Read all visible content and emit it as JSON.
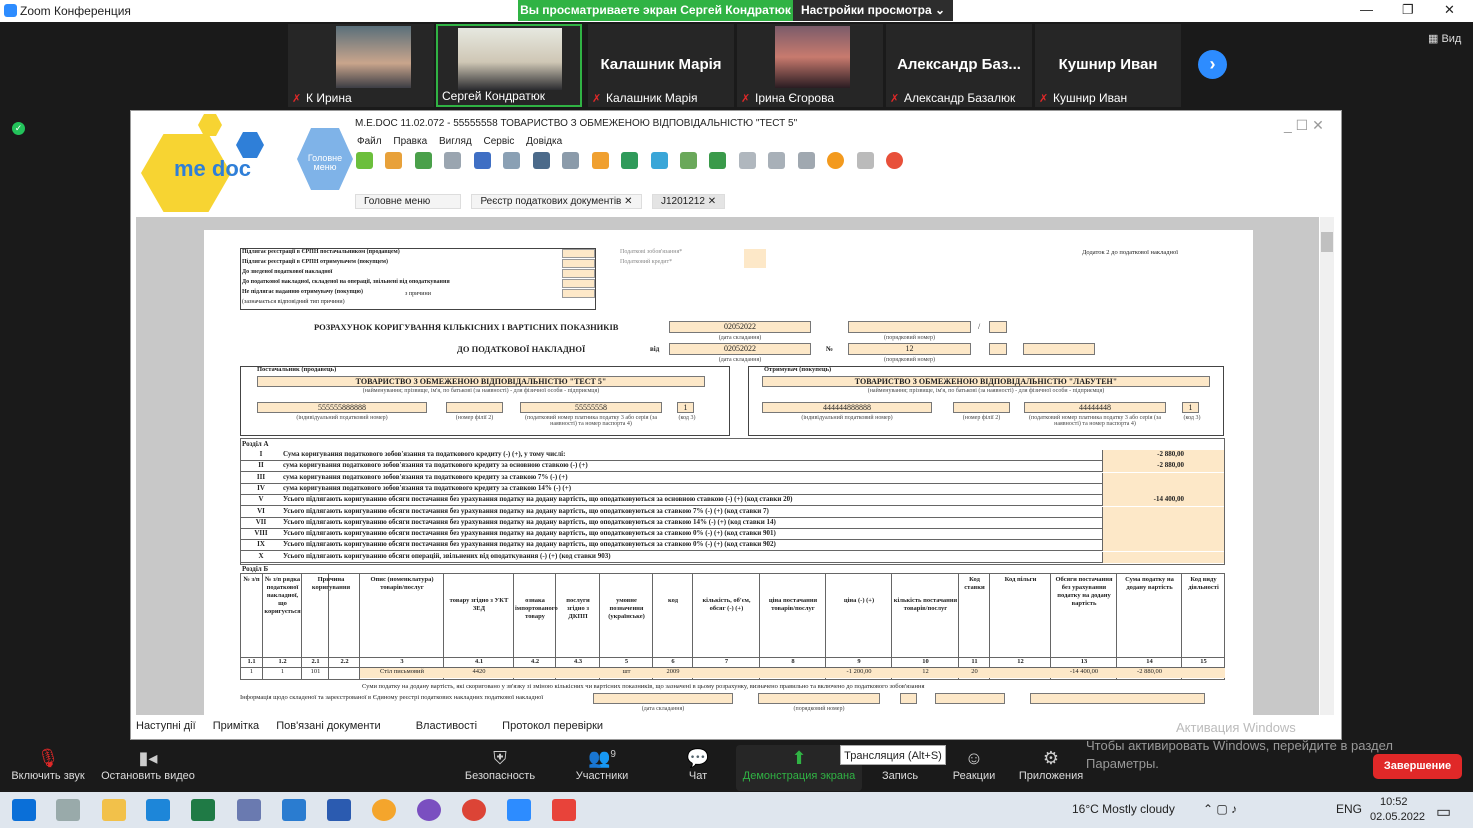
{
  "window": {
    "app_title": "Zoom Конференция",
    "minimize": "—",
    "maximize": "❐",
    "close": "✕"
  },
  "banner": {
    "sharing_text": "Вы просматриваете экран Сергей Кондратюк",
    "view_options": "Настройки просмотра ⌄"
  },
  "participants": [
    {
      "name": "К Ирина",
      "has_video": true,
      "muted": true
    },
    {
      "name": "Сергей Кондратюк",
      "has_video": true,
      "muted": false
    },
    {
      "name": "Калашник Марія",
      "big_name": "Калашник Марія",
      "has_video": false,
      "muted": true
    },
    {
      "name": "Ірина Єгорова",
      "has_video": true,
      "muted": true
    },
    {
      "name": "Александр Базалюк",
      "big_name": "Александр Баз...",
      "has_video": false,
      "muted": true
    },
    {
      "name": "Кушнир Иван",
      "big_name": "Кушнир Иван",
      "has_video": false,
      "muted": true
    }
  ],
  "view_label": "Вид",
  "medoc": {
    "logo": "me doc",
    "home_logo": "Головне меню",
    "title": "M.E.DOC 11.02.072 - 55555558 ТОВАРИСТВО З ОБМЕЖЕНОЮ ВІДПОВІДАЛЬНІСТЮ \"ТЕСТ 5\"",
    "menu": [
      "Файл",
      "Правка",
      "Вигляд",
      "Сервіс",
      "Довідка"
    ],
    "tabs": [
      "Головне меню",
      "Реєстр податкових документів",
      "J1201212"
    ],
    "bottom_tabs": [
      "Наступні дії",
      "Примітка",
      "Пов'язані документи",
      "Властивості",
      "Протокол перевірки"
    ]
  },
  "doc": {
    "reg_rows": [
      "Підлягає реєстрації в ЄРПН постачальником (продавцем)",
      "Підлягає реєстрації в ЄРПН отримувачем (покупцем)",
      "До зведеної податкової накладної",
      "До податкової накладної, складеної на операції, звільнені від оподаткування",
      "Не підлягає наданню отримувачу (покупцю)",
      "(зазначається відповідний тип причини)"
    ],
    "reason_label": "з причини",
    "tax_obligation": "Податкові зобов'язання*",
    "tax_credit": "Податковий кредит*",
    "appendix": "Додаток 2 до податкової накладної",
    "title1": "РОЗРАХУНОК КОРИГУВАННЯ КІЛЬКІСНИХ І ВАРТІСНИХ ПОКАЗНИКІВ",
    "title2": "ДО ПОДАТКОВОЇ НАКЛАДНОЇ",
    "from": "від",
    "no": "№",
    "slash": "/",
    "date1": "02052022",
    "date2": "02052022",
    "number2": "12",
    "cap_date": "(дата складання)",
    "cap_number": "(порядковий номер)",
    "supplier_hdr": "Постачальник (продавець)",
    "buyer_hdr": "Отримувач (покупець)",
    "supplier_name": "ТОВАРИСТВО З ОБМЕЖЕНОЮ ВІДПОВІДАЛЬНІСТЮ \"ТЕСТ 5\"",
    "buyer_name": "ТОВАРИСТВО З ОБМЕЖЕНОЮ ВІДПОВІДАЛЬНІСТЮ \"ЛАБУТЕН\"",
    "cap_name": "(найменування; прізвище, ім'я, по батькові (за наявності) - для фізичної особи - підприємця)",
    "supplier_ipn": "555555888888",
    "supplier_code": "55555558",
    "buyer_ipn": "444444888888",
    "buyer_code": "44444448",
    "one": "1",
    "cap_ipn": "(індивідуальний податковий номер)",
    "cap_branch": "(номер філії 2)",
    "cap_code": "(податковий номер платника податку 3 або серія (за наявності) та номер паспорта 4)",
    "cap_k3": "(код 3)",
    "section_a": "Розділ А",
    "section_b": "Розділ Б",
    "rows_a": [
      {
        "n": "I",
        "t": "Сума коригування податкового зобов'язання та податкового кредиту (-) (+), у тому числі:",
        "v": "-2 880,00"
      },
      {
        "n": "II",
        "t": "сума коригування податкового зобов'язання та податкового кредиту за основною ставкою (-) (+)",
        "v": "-2 880,00"
      },
      {
        "n": "III",
        "t": "сума коригування податкового зобов'язання та податкового кредиту за ставкою 7% (-) (+)",
        "v": ""
      },
      {
        "n": "IV",
        "t": "сума коригування податкового зобов'язання та податкового кредиту за ставкою 14% (-) (+)",
        "v": ""
      },
      {
        "n": "V",
        "t": "Усього підлягають коригуванню обсяги постачання без урахування податку на додану вартість, що оподатковуються за основною ставкою (-) (+) (код ставки 20)",
        "v": "-14 400,00"
      },
      {
        "n": "VI",
        "t": "Усього підлягають коригуванню обсяги постачання без урахування податку на додану вартість, що оподатковуються за ставкою 7% (-) (+) (код ставки 7)",
        "v": ""
      },
      {
        "n": "VII",
        "t": "Усього підлягають коригуванню обсяги постачання без урахування податку на додану вартість, що оподатковуються за ставкою 14% (-) (+) (код ставки 14)",
        "v": ""
      },
      {
        "n": "VIII",
        "t": "Усього підлягають коригуванню обсяги постачання без урахування податку на додану вартість, що оподатковуються за ставкою 0% (-) (+) (код ставки 901)",
        "v": ""
      },
      {
        "n": "IX",
        "t": "Усього підлягають коригуванню обсяги постачання без урахування податку на додану вартість, що оподатковуються за ставкою 0% (-) (+) (код ставки 902)",
        "v": ""
      },
      {
        "n": "X",
        "t": "Усього підлягають коригуванню обсяги операцій, звільнених від оподаткування (-) (+) (код ставки 903)",
        "v": ""
      }
    ],
    "cols_b": [
      "№ з/п",
      "№ з/п рядка податкової накладної, що коригується",
      "Причина коригування",
      "Опис (номенклатура) товарів/послуг",
      "товару згідно з УКТ ЗЕД",
      "ознака імпортованого товару",
      "послуги згідно з ДКПП",
      "умовне позначення (українське)",
      "код",
      "кількість, об'єм, обсяг (-) (+)",
      "ціна постачання товарів/послуг",
      "ціна (-) (+)",
      "кількість постачання товарів/послуг",
      "Код ставки",
      "Код пільги",
      "Обсяги постачання без урахування податку на додану вартість",
      "Сума податку на додану вартість",
      "Код виду діяльності"
    ],
    "col_nums": [
      "1.1",
      "1.2",
      "2.1",
      "2.2",
      "3",
      "4.1",
      "4.2",
      "4.3",
      "5",
      "6",
      "7",
      "8",
      "9",
      "10",
      "11",
      "12",
      "13",
      "14",
      "15"
    ],
    "row_b": [
      "1",
      "1",
      "101",
      "",
      "Стіл письмовий",
      "4420",
      "",
      "",
      "шт",
      "2009",
      "",
      "",
      "-1 200,00",
      "12",
      "20",
      "",
      "-14 400,00",
      "-2 880,00",
      ""
    ],
    "footer_note": "Суми податку на додану вартість, які скориговано у зв'язку зі зміною кількісних чи вартісних показників, що зазначені в цьому розрахунку, визначено правильно та включено до податкового зобов'язання",
    "info_line": "Інформація щодо складеної та зареєстрованої в Єдиному реєстрі податкових накладних податкової накладної"
  },
  "activate": {
    "line1": "Активация Windows",
    "line2": "Чтобы активировать Windows, перейдите в раздел",
    "line3": "Параметры."
  },
  "controls": {
    "mute": "Включить звук",
    "video": "Остановить видео",
    "security": "Безопасность",
    "participants": "Участники",
    "participants_count": "9",
    "chat": "Чат",
    "share": "Демонстрация экрана",
    "record": "Запись",
    "reactions": "Реакции",
    "apps": "Приложения",
    "end": "Завершение",
    "tooltip": "Трансляция (Alt+S)"
  },
  "taskbar": {
    "weather": "16°C  Mostly cloudy",
    "lang": "ENG",
    "time": "10:52",
    "date": "02.05.2022"
  },
  "colors": {
    "zoom_blue": "#2d8cff",
    "green": "#30b344",
    "end_red": "#e02828",
    "field_fill": "#fde8c8"
  }
}
